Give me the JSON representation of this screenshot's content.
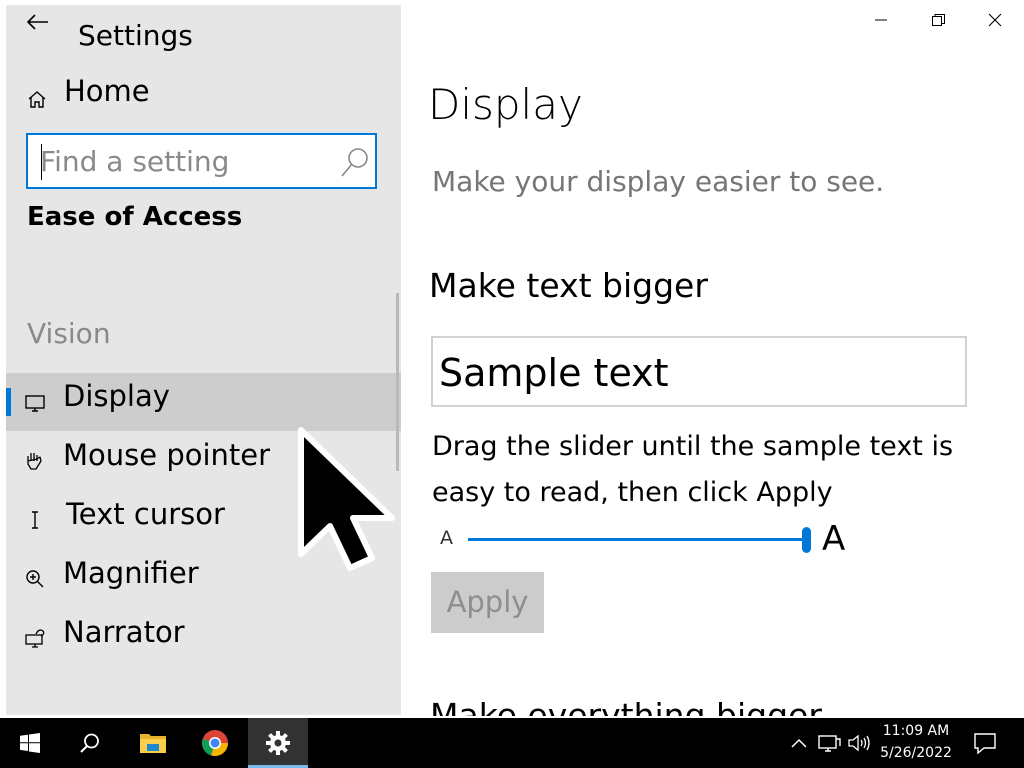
{
  "window": {
    "title": "Settings"
  },
  "sidebar": {
    "home_label": "Home",
    "search_placeholder": "Find a setting",
    "search_value": "",
    "section_title": "Ease of Access",
    "group_title": "Vision",
    "items": [
      {
        "label": "Display",
        "icon": "display-icon",
        "selected": true
      },
      {
        "label": "Mouse pointer",
        "icon": "mouse-pointer-icon",
        "selected": false
      },
      {
        "label": "Text cursor",
        "icon": "text-cursor-icon",
        "selected": false
      },
      {
        "label": "Magnifier",
        "icon": "magnifier-icon",
        "selected": false
      },
      {
        "label": "Narrator",
        "icon": "narrator-icon",
        "selected": false
      }
    ]
  },
  "content": {
    "title": "Display",
    "description": "Make your display easier to see.",
    "text_size": {
      "heading": "Make text bigger",
      "sample": "Sample text",
      "instruction": "Drag the slider until the sample text is easy to read, then click Apply",
      "slider_min_label": "A",
      "slider_max_label": "A",
      "slider_value_percent": 100,
      "apply_label": "Apply"
    },
    "next_heading": "Make everything bigger"
  },
  "taskbar": {
    "apps": [
      "start-icon",
      "search-icon",
      "file-explorer-icon",
      "chrome-icon",
      "settings-icon"
    ],
    "active_app": "settings-icon",
    "clock_time": "11:09 AM",
    "clock_date": "5/26/2022"
  },
  "colors": {
    "accent": "#0078d7",
    "sidebar_bg": "#e6e6e6",
    "selected_bg": "#cdcdcd",
    "taskbar_bg": "#000000"
  }
}
